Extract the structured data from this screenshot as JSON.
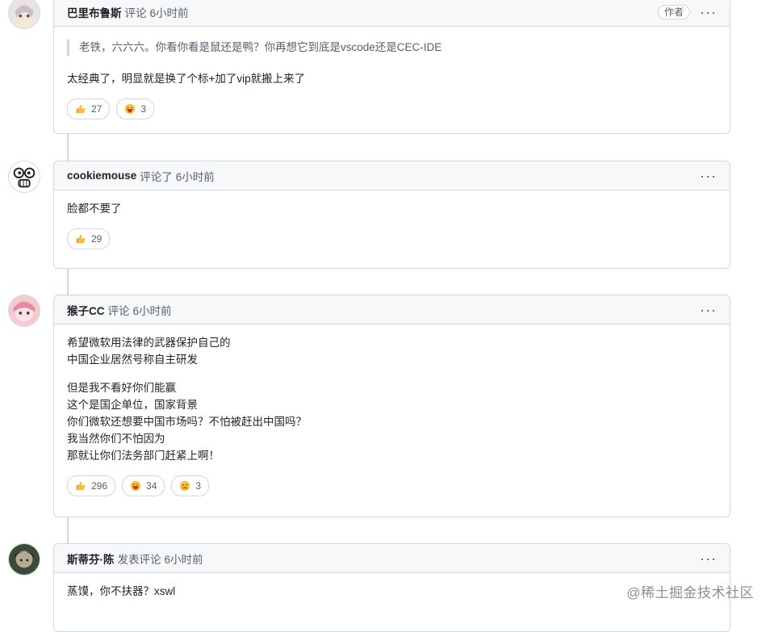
{
  "comments": [
    {
      "author": "巴里布鲁斯",
      "action": "评论",
      "time": "6小时前",
      "badge": "作者",
      "quote": "老铁，六六六。你看你看是鼠还是鸭？你再想它到底是vscode还是CEC-IDE",
      "paragraphs": [
        [
          "太经典了，明显就是换了个标+加了vip就搬上来了"
        ]
      ],
      "reactions": [
        {
          "emoji": "thumbs-up",
          "count": "27"
        },
        {
          "emoji": "laugh",
          "count": "3"
        }
      ]
    },
    {
      "author": "cookiemouse",
      "action": "评论了",
      "time": "6小时前",
      "paragraphs": [
        [
          "脸都不要了"
        ]
      ],
      "reactions": [
        {
          "emoji": "thumbs-up",
          "count": "29"
        }
      ]
    },
    {
      "author": "猴子CC",
      "action": "评论",
      "time": "6小时前",
      "paragraphs": [
        [
          "希望微软用法律的武器保护自己的",
          "中国企业居然号称自主研发"
        ],
        [
          "但是我不看好你们能赢",
          "这个是国企单位，国家背景",
          "你们微软还想要中国市场吗？不怕被赶出中国吗？",
          "我当然你们不怕因为",
          "那就让你们法务部门赶紧上啊！"
        ]
      ],
      "reactions": [
        {
          "emoji": "thumbs-up",
          "count": "296"
        },
        {
          "emoji": "laugh",
          "count": "34"
        },
        {
          "emoji": "confused",
          "count": "3"
        }
      ]
    },
    {
      "author": "斯蒂芬·陈",
      "action": "发表评论",
      "time": "6小时前",
      "paragraphs": [
        [
          "蒸馍，你不扶器？xswl"
        ]
      ],
      "reactions": []
    }
  ],
  "watermark": "@稀土掘金技术社区"
}
